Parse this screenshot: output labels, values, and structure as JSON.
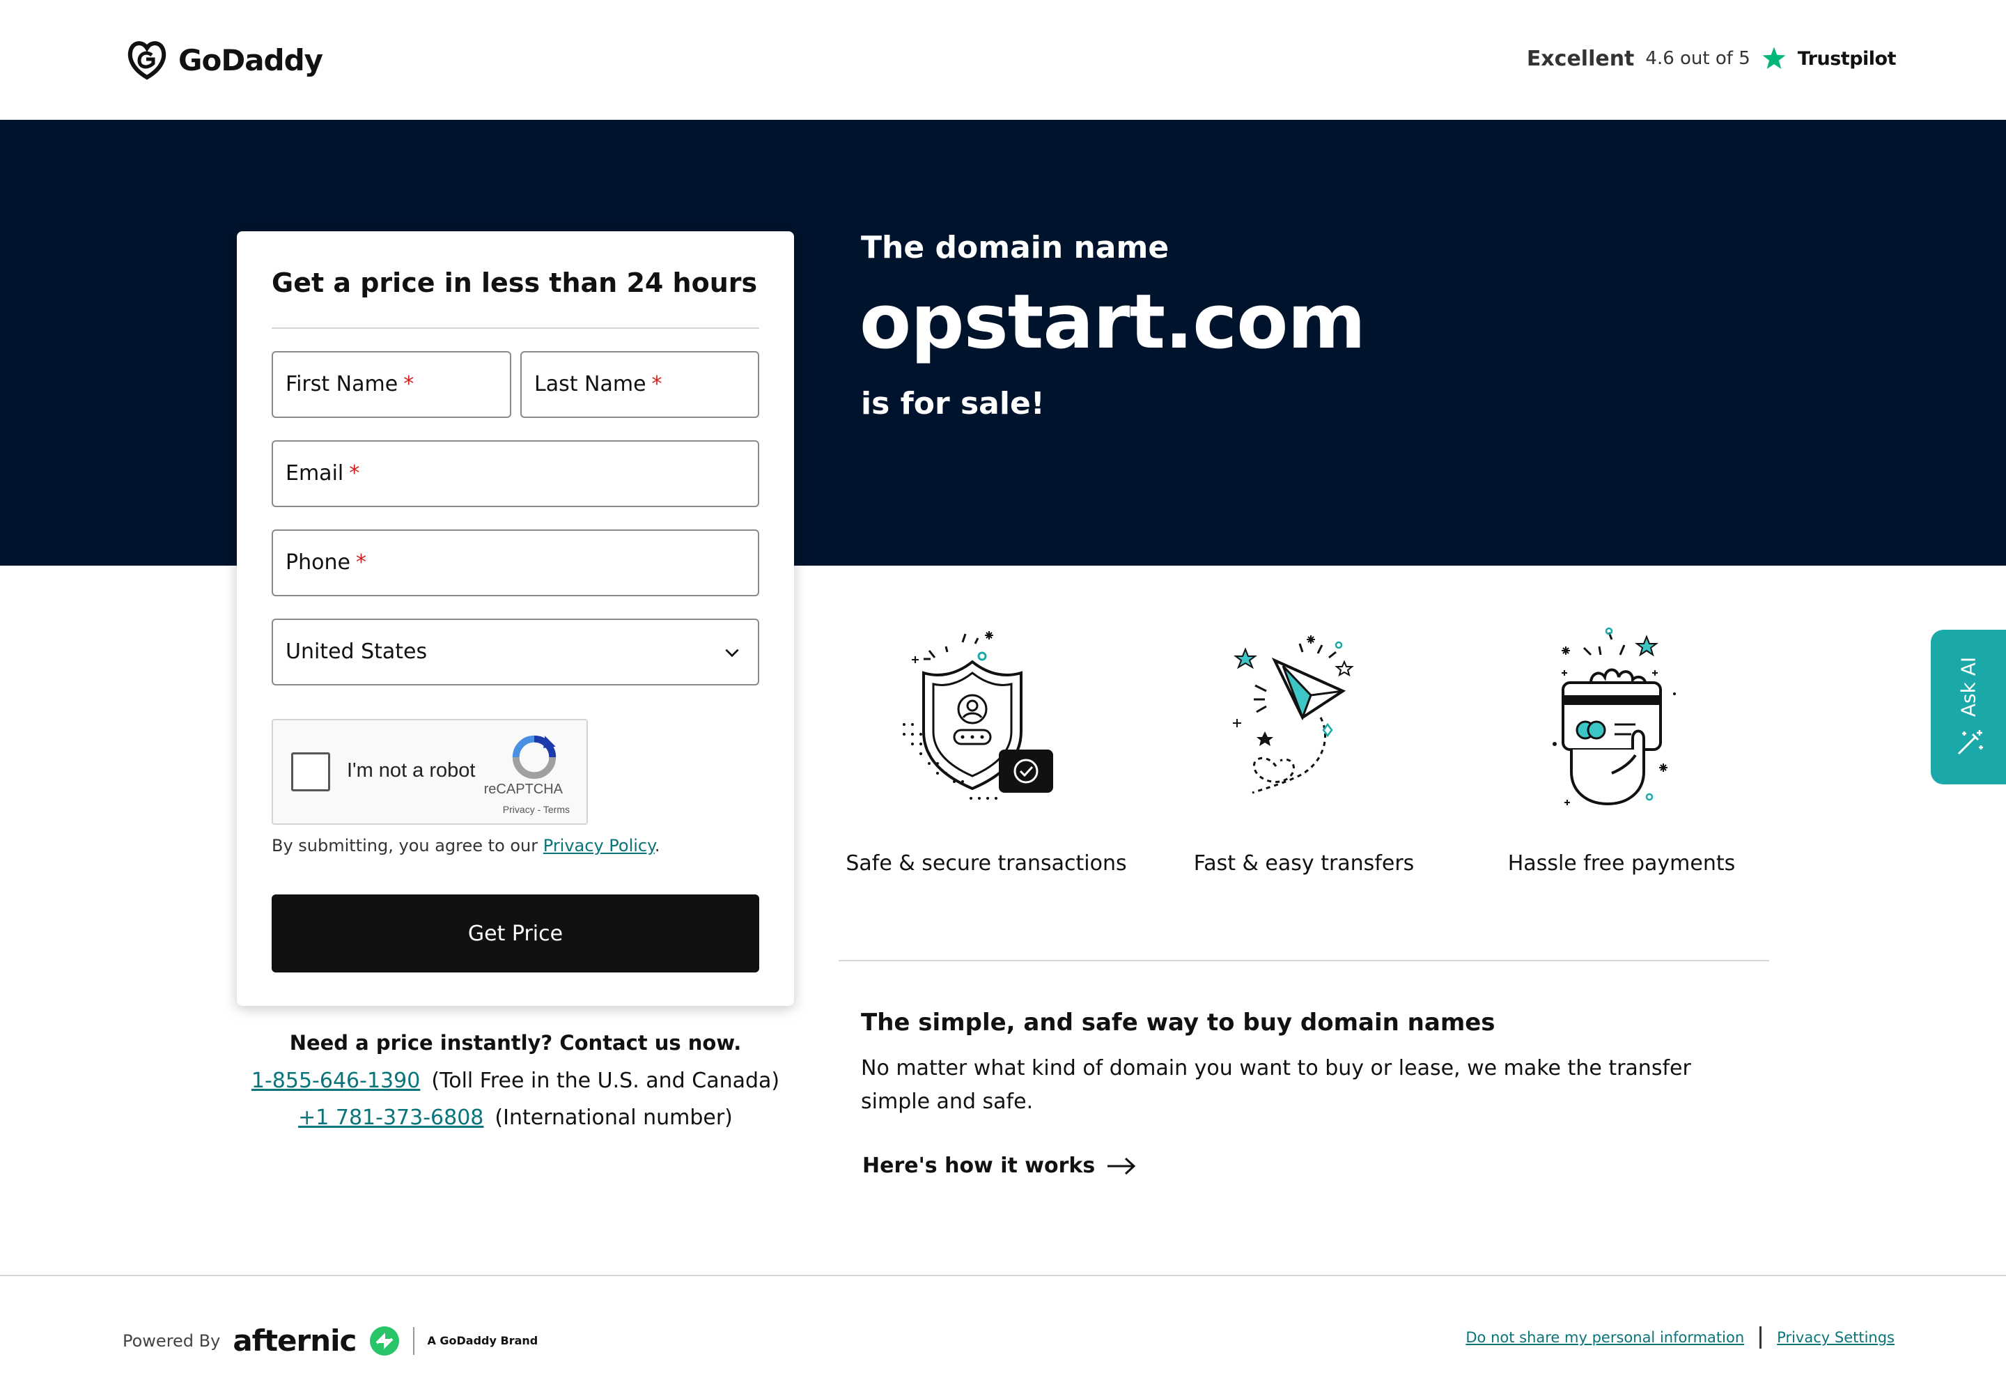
{
  "header": {
    "logo_text": "GoDaddy",
    "trustpilot": {
      "rating_word": "Excellent",
      "score": "4.6 out of 5",
      "brand": "Trustpilot"
    }
  },
  "hero": {
    "line1": "The domain name",
    "domain": "opstart.com",
    "line2": "is for sale!"
  },
  "form": {
    "title": "Get a price in less than 24 hours",
    "first_name_label": "First Name",
    "last_name_label": "Last Name",
    "email_label": "Email",
    "phone_label": "Phone",
    "required_marker": "*",
    "country_value": "United States",
    "captcha": {
      "label": "I'm not a robot",
      "brand": "reCAPTCHA",
      "links": "Privacy - Terms"
    },
    "agree_prefix": "By submitting, you agree to our ",
    "privacy_link": "Privacy Policy",
    "agree_suffix": ".",
    "submit_label": "Get Price"
  },
  "contact": {
    "question": "Need a price instantly? Contact us now.",
    "phones": [
      {
        "number": "1-855-646-1390",
        "note": "(Toll Free in the U.S. and Canada)"
      },
      {
        "number": "+1 781-373-6808",
        "note": "(International number)"
      }
    ]
  },
  "features": [
    {
      "icon": "shield-icon",
      "caption": "Safe & secure transactions"
    },
    {
      "icon": "paper-plane-icon",
      "caption": "Fast & easy transfers"
    },
    {
      "icon": "card-payment-icon",
      "caption": "Hassle free payments"
    }
  ],
  "info": {
    "title": "The simple, and safe way to buy domain names",
    "body": "No matter what kind of domain you want to buy or lease, we make the transfer simple and safe.",
    "link": "Here's how it works"
  },
  "ask_ai": {
    "label": "Ask AI"
  },
  "footer": {
    "powered_by": "Powered By",
    "afternic": "afternic",
    "godaddy_brand": "A GoDaddy Brand",
    "links": [
      "Do not share my personal information",
      "Privacy Settings"
    ]
  },
  "colors": {
    "hero_bg": "#00132c",
    "accent_teal": "#09757a",
    "ask_ai_bg": "#1aa8a8",
    "button_bg": "#111111",
    "trustpilot_star": "#00b67a"
  }
}
